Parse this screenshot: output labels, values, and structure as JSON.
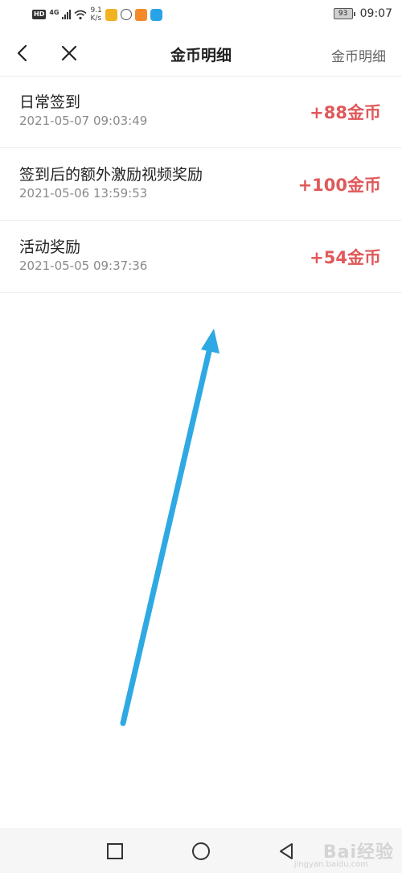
{
  "status_bar": {
    "hd": "HD",
    "network": "4G",
    "speed_value": "9.1",
    "speed_unit": "K/s",
    "battery": "93",
    "time": "09:07",
    "app_icons": [
      {
        "name": "news-app-icon",
        "color": "#f2b320"
      },
      {
        "name": "browser-app-icon",
        "color": "#555555"
      },
      {
        "name": "video-app-icon",
        "color": "#f58a2a"
      },
      {
        "name": "assistant-app-icon",
        "color": "#2aa3e6"
      }
    ]
  },
  "nav": {
    "title": "金币明细",
    "right_label": "金币明细",
    "back_icon": "chevron-left-icon",
    "close_icon": "close-icon"
  },
  "records": [
    {
      "title": "日常签到",
      "time": "2021-05-07 09:03:49",
      "amount": "+88金币"
    },
    {
      "title": "签到后的额外激励视频奖励",
      "time": "2021-05-06 13:59:53",
      "amount": "+100金币"
    },
    {
      "title": "活动奖励",
      "time": "2021-05-05 09:37:36",
      "amount": "+54金币"
    }
  ],
  "system_nav": {
    "recent_icon": "square-icon",
    "home_icon": "circle-icon",
    "back_icon": "triangle-back-icon"
  },
  "watermark": {
    "main": "Bai经验",
    "sub": "jingyan.baidu.com"
  },
  "colors": {
    "amount": "#e0595a",
    "arrow": "#2fa9e3"
  }
}
